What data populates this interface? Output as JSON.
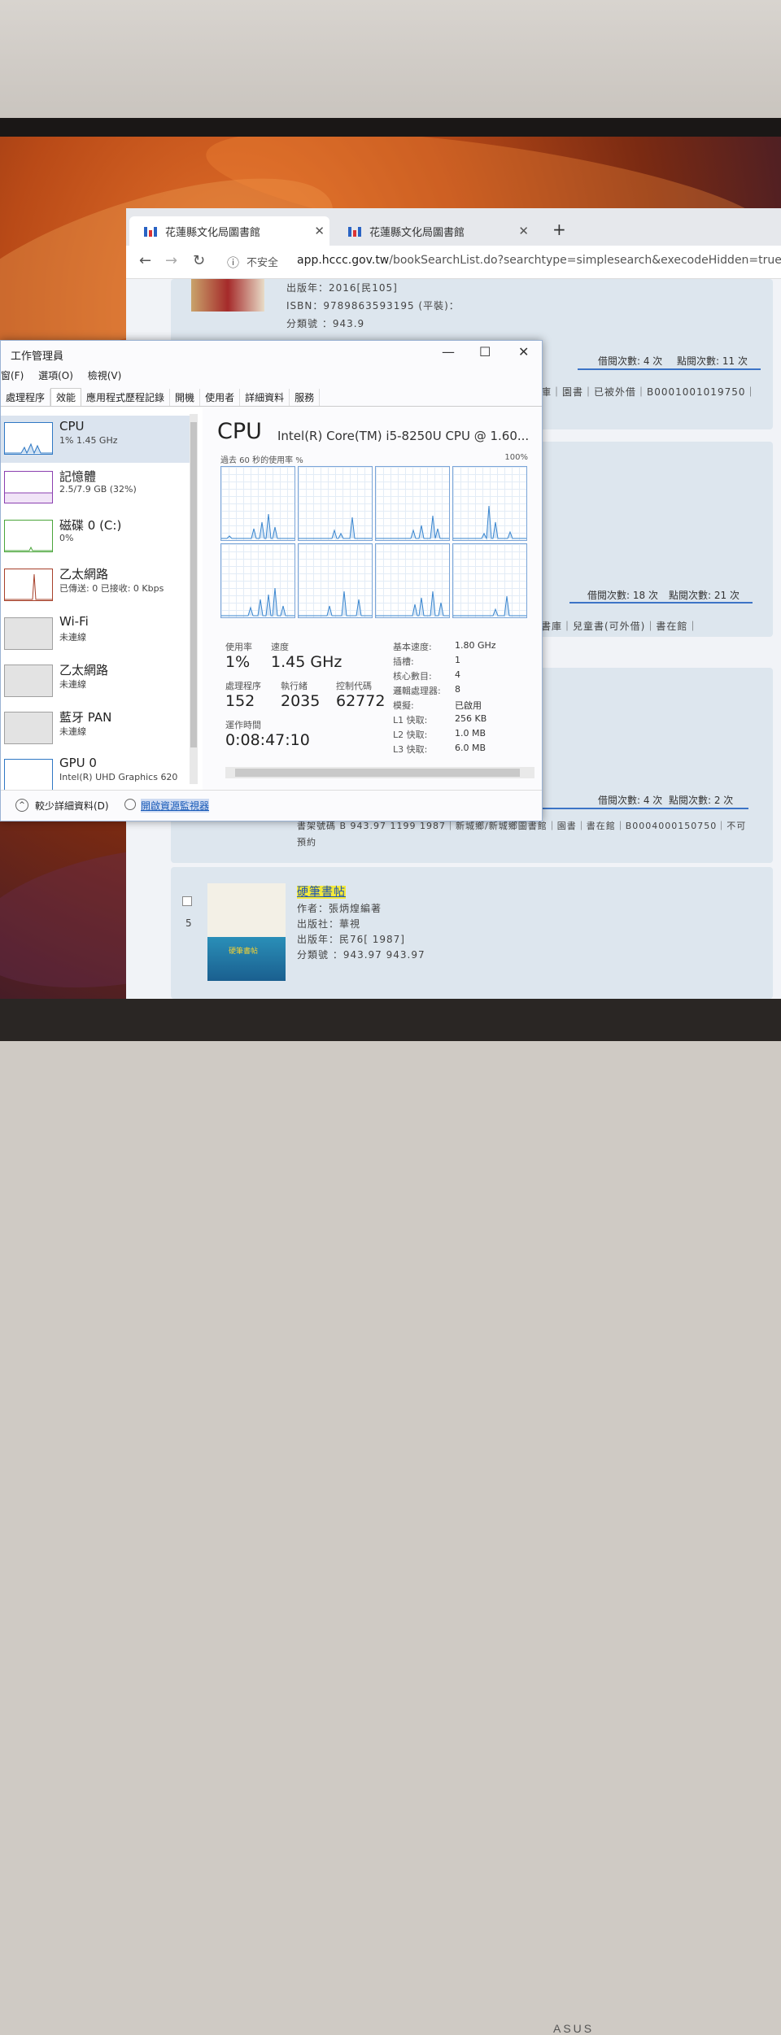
{
  "browser": {
    "tabs": [
      {
        "label": "花蓮縣文化局圖書館"
      },
      {
        "label": "花蓮縣文化局圖書館"
      }
    ],
    "new_tab": "+",
    "nav": {
      "back": "←",
      "forward": "→",
      "reload": "↻",
      "info": "ⓘ"
    },
    "security": "不安全",
    "url_host": "app.hccc.gov.tw",
    "url_path": "/bookSearchList.do?searchtype=simplesearch&execodeHidden=true&e"
  },
  "results": {
    "item_top": {
      "publish_year": "出版年：2016[民105]",
      "isbn": "ISBN：9789863593195 (平裝)：",
      "call_number": "分類號 ：943.9",
      "borrow": "借閱次數: 4 次",
      "clicks": "點閱次數: 11 次",
      "holdings": "庫｜園書｜已被外借｜B0001001019750｜"
    },
    "item_mid": {
      "borrow": "借閱次數: 18 次",
      "clicks": "點閱次數: 21 次",
      "holdings": "書庫｜兒童書(可外借)｜書在館｜"
    },
    "item_4": {
      "borrow": "借閱次數: 4 次",
      "clicks": "點閱次數: 2 次",
      "holdings": "書架號碼 B 943.97 1199 1987｜新城鄉/新城鄉圖書館｜園書｜書在館｜B00040001​50750｜不可",
      "holdings2": "預約"
    },
    "item_5": {
      "index": "5",
      "title": "硬筆書帖",
      "author": "作者：張炳煌編著",
      "publisher": "出版社：華視",
      "publish_year": "出版年：民76[ 1987]",
      "call_number": "分類號 ：943.97 943.97",
      "cover_text": "硬筆書帖"
    }
  },
  "task_manager": {
    "title": "工作管理員",
    "window_controls": {
      "minimize": "—",
      "maximize": "☐",
      "close": "✕"
    },
    "menu": [
      "窗(F)",
      "選項(O)",
      "檢視(V)"
    ],
    "tabs": [
      "處理程序",
      "效能",
      "應用程式歷程記錄",
      "開機",
      "使用者",
      "詳細資料",
      "服務"
    ],
    "sidebar": [
      {
        "name": "CPU",
        "sub": "1% 1.45 GHz",
        "color": "#2f78c4"
      },
      {
        "name": "記憶體",
        "sub": "2.5/7.9 GB (32%)",
        "color": "#8b3fb0"
      },
      {
        "name": "磁碟 0 (C:)",
        "sub": "0%",
        "color": "#4aa53a"
      },
      {
        "name": "乙太網路",
        "sub": "已傳送: 0 已接收: 0 Kbps",
        "color": "#a7402a"
      },
      {
        "name": "Wi-Fi",
        "sub": "未連線",
        "color": "#a0a0a0"
      },
      {
        "name": "乙太網路",
        "sub": "未連線",
        "color": "#a0a0a0"
      },
      {
        "name": "藍牙 PAN",
        "sub": "未連線",
        "color": "#a0a0a0"
      },
      {
        "name": "GPU 0",
        "sub": "Intel(R) UHD Graphics 620",
        "color": "#2f78c4"
      }
    ],
    "cpu": {
      "heading": "CPU",
      "model": "Intel(R) Core(TM) i5-8250U CPU @ 1.60...",
      "graph_caption": "過去 60 秒的使用率 %",
      "graph_max": "100%",
      "usage_label": "使用率",
      "usage_value": "1%",
      "speed_label": "速度",
      "speed_value": "1.45 GHz",
      "processes_label": "處理程序",
      "processes_value": "152",
      "threads_label": "執行緒",
      "threads_value": "2035",
      "handles_label": "控制代碼",
      "handles_value": "62772",
      "uptime_label": "運作時間",
      "uptime_value": "0:08:47:10",
      "details": [
        {
          "k": "基本速度:",
          "v": "1.80 GHz"
        },
        {
          "k": "插槽:",
          "v": "1"
        },
        {
          "k": "核心數目:",
          "v": "4"
        },
        {
          "k": "邏輯處理器:",
          "v": "8"
        },
        {
          "k": "模擬:",
          "v": "已啟用"
        },
        {
          "k": "L1 快取:",
          "v": "256 KB"
        },
        {
          "k": "L2 快取:",
          "v": "1.0 MB"
        },
        {
          "k": "L3 快取:",
          "v": "6.0 MB"
        }
      ]
    },
    "footer": {
      "less": "較少詳細資料(D)",
      "monitor": "開啟資源監視器"
    }
  },
  "brand": "ASUS"
}
